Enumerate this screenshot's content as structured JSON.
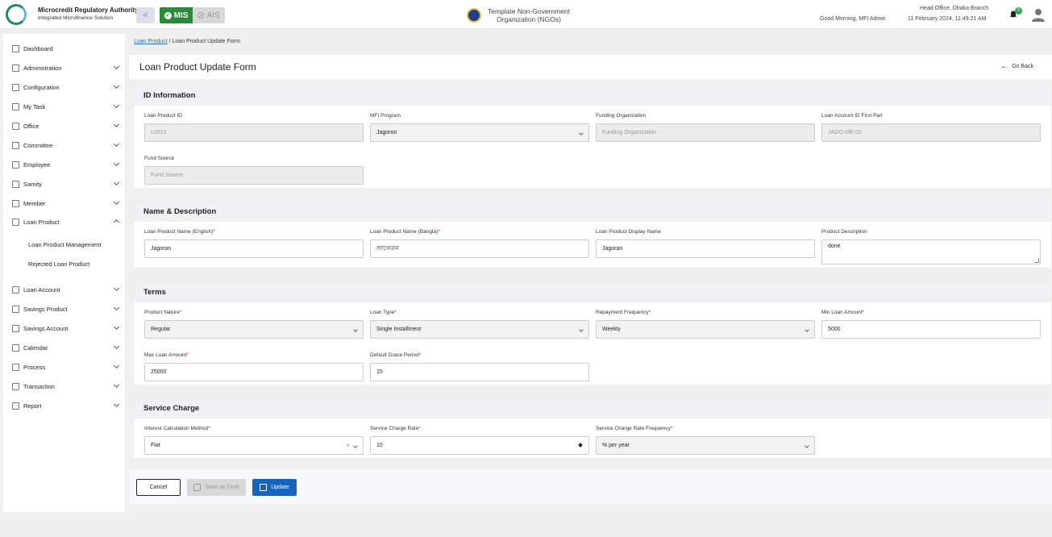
{
  "header": {
    "org_name": "Microcredit Regulatory Authority",
    "org_sub": "Integrated Microfinance Solution",
    "mode_mis": "MIS",
    "mode_ais": "AIS",
    "template_line1": "Template Non-Government",
    "template_line2": "Organization (NGOs)",
    "greeting": "Good Morning, MFI Admin",
    "branch": "Head Office, Dhaka Branch",
    "datetime": "11 February 2024, 11:49:21 AM",
    "notification_count": "0"
  },
  "sidebar": {
    "dashboard": "Dashboard",
    "items": [
      {
        "label": "Administration"
      },
      {
        "label": "Configuration"
      },
      {
        "label": "My Task"
      },
      {
        "label": "Office"
      },
      {
        "label": "Committee"
      },
      {
        "label": "Employee"
      },
      {
        "label": "Samity"
      },
      {
        "label": "Member"
      },
      {
        "label": "Loan Product"
      }
    ],
    "sub_items": [
      {
        "label": "Loan Product Management"
      },
      {
        "label": "Rejected Loan Product"
      }
    ],
    "items_after": [
      {
        "label": "Loan Account"
      },
      {
        "label": "Savings Product"
      },
      {
        "label": "Savings Account"
      },
      {
        "label": "Calendar"
      },
      {
        "label": "Process"
      },
      {
        "label": "Transaction"
      },
      {
        "label": "Report"
      }
    ]
  },
  "breadcrumb": {
    "link": "Loan Product",
    "sep": "/",
    "current": "Loan Product Update Form"
  },
  "page": {
    "title": "Loan Product Update Form",
    "go_back": "Go Back"
  },
  "id_info": {
    "title": "ID Information",
    "loan_product_id": {
      "label": "Loan Product ID",
      "value": "L0010"
    },
    "mfi_program": {
      "label": "MFI Program",
      "value": "Jagoron"
    },
    "funding_org": {
      "label": "Funding Organization",
      "placeholder": "Funding Organization"
    },
    "loan_account_first": {
      "label": "Loan Account ID First Part",
      "value": "JAGO-ME-01"
    },
    "fund_source": {
      "label": "Fund Source",
      "placeholder": "Fund Source"
    }
  },
  "name_desc": {
    "title": "Name & Description",
    "name_en": {
      "label": "Loan Product Name (English)",
      "value": "Jagoran"
    },
    "name_bn": {
      "label": "Loan Product Name (Bangla)",
      "value": "জাগোরান"
    },
    "display_name": {
      "label": "Loan Product Display Name",
      "value": "Jagoran"
    },
    "description": {
      "label": "Product Description",
      "value": "done"
    }
  },
  "terms": {
    "title": "Terms",
    "product_nature": {
      "label": "Product Nature",
      "value": "Regular"
    },
    "loan_type": {
      "label": "Loan Type",
      "value": "Single Installment"
    },
    "repayment_freq": {
      "label": "Repayment Frequency",
      "value": "Weekly"
    },
    "min_amount": {
      "label": "Min Loan Amount",
      "value": "5000"
    },
    "max_amount": {
      "label": "Max Loan Amount",
      "value": "25000"
    },
    "grace_period": {
      "label": "Default Grace Period",
      "value": "15"
    }
  },
  "service_charge": {
    "title": "Service Charge",
    "calc_method": {
      "label": "Interest Calculation Method",
      "value": "Flat"
    },
    "rate": {
      "label": "Service Charge Rate",
      "value": "10"
    },
    "rate_freq": {
      "label": "Service Charge Rate Frequency",
      "value": "% per year"
    }
  },
  "actions": {
    "cancel": "Cancel",
    "draft": "Save as Draft",
    "update": "Update"
  },
  "required_mark": "*",
  "colors": {
    "primary": "#1565c0",
    "mis_green": "#2a8a3a",
    "required": "#e02424"
  }
}
